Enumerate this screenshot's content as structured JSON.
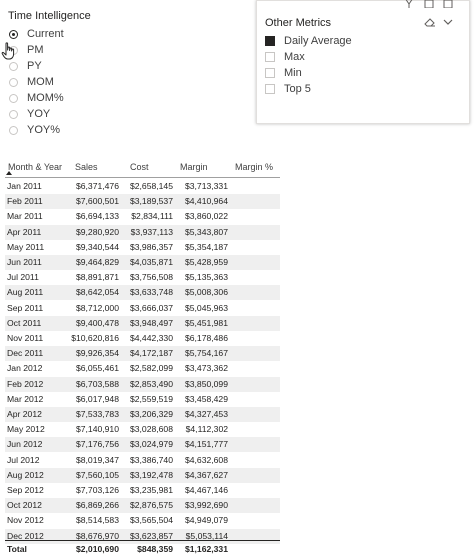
{
  "time_slicer": {
    "title": "Time Intelligence",
    "options": [
      {
        "label": "Current",
        "selected": true
      },
      {
        "label": "PM",
        "selected": false
      },
      {
        "label": "PY",
        "selected": false
      },
      {
        "label": "MOM",
        "selected": false
      },
      {
        "label": "MOM%",
        "selected": false
      },
      {
        "label": "YOY",
        "selected": false
      },
      {
        "label": "YOY%",
        "selected": false
      }
    ]
  },
  "metrics_slicer": {
    "title": "Other Metrics",
    "options": [
      {
        "label": "Daily Average",
        "checked": true
      },
      {
        "label": "Max",
        "checked": false
      },
      {
        "label": "Min",
        "checked": false
      },
      {
        "label": "Top 5",
        "checked": false
      }
    ]
  },
  "table": {
    "columns": [
      "Month & Year",
      "Sales",
      "Cost",
      "Margin",
      "Margin %"
    ],
    "rows": [
      [
        "Jan 2011",
        "$6,371,476",
        "$2,658,145",
        "$3,713,331"
      ],
      [
        "Feb 2011",
        "$7,600,501",
        "$3,189,537",
        "$4,410,964"
      ],
      [
        "Mar 2011",
        "$6,694,133",
        "$2,834,111",
        "$3,860,022"
      ],
      [
        "Apr 2011",
        "$9,280,920",
        "$3,937,113",
        "$5,343,807"
      ],
      [
        "May 2011",
        "$9,340,544",
        "$3,986,357",
        "$5,354,187"
      ],
      [
        "Jun 2011",
        "$9,464,829",
        "$4,035,871",
        "$5,428,959"
      ],
      [
        "Jul 2011",
        "$8,891,871",
        "$3,756,508",
        "$5,135,363"
      ],
      [
        "Aug 2011",
        "$8,642,054",
        "$3,633,748",
        "$5,008,306"
      ],
      [
        "Sep 2011",
        "$8,712,000",
        "$3,666,037",
        "$5,045,963"
      ],
      [
        "Oct 2011",
        "$9,400,478",
        "$3,948,497",
        "$5,451,981"
      ],
      [
        "Nov 2011",
        "$10,620,816",
        "$4,442,330",
        "$6,178,486"
      ],
      [
        "Dec 2011",
        "$9,926,354",
        "$4,172,187",
        "$5,754,167"
      ],
      [
        "Jan 2012",
        "$6,055,461",
        "$2,582,099",
        "$3,473,362"
      ],
      [
        "Feb 2012",
        "$6,703,588",
        "$2,853,490",
        "$3,850,099"
      ],
      [
        "Mar 2012",
        "$6,017,948",
        "$2,559,519",
        "$3,458,429"
      ],
      [
        "Apr 2012",
        "$7,533,783",
        "$3,206,329",
        "$4,327,453"
      ],
      [
        "May 2012",
        "$7,140,910",
        "$3,028,608",
        "$4,112,302"
      ],
      [
        "Jun 2012",
        "$7,176,756",
        "$3,024,979",
        "$4,151,777"
      ],
      [
        "Jul 2012",
        "$8,019,347",
        "$3,386,740",
        "$4,632,608"
      ],
      [
        "Aug 2012",
        "$7,560,105",
        "$3,192,478",
        "$4,367,627"
      ],
      [
        "Sep 2012",
        "$7,703,126",
        "$3,235,981",
        "$4,467,146"
      ],
      [
        "Oct 2012",
        "$6,869,266",
        "$2,876,575",
        "$3,992,690"
      ],
      [
        "Nov 2012",
        "$8,514,583",
        "$3,565,504",
        "$4,949,079"
      ],
      [
        "Dec 2012",
        "$8,676,970",
        "$3,623,857",
        "$5,053,114"
      ]
    ],
    "total": [
      "Total",
      "$2,010,690",
      "$848,359",
      "$1,162,331"
    ]
  },
  "icons": {
    "cursor": "hand-pointer-icon",
    "eraser": "eraser-icon",
    "chevron": "chevron-down-icon",
    "sort": "sort-ascending-icon"
  }
}
